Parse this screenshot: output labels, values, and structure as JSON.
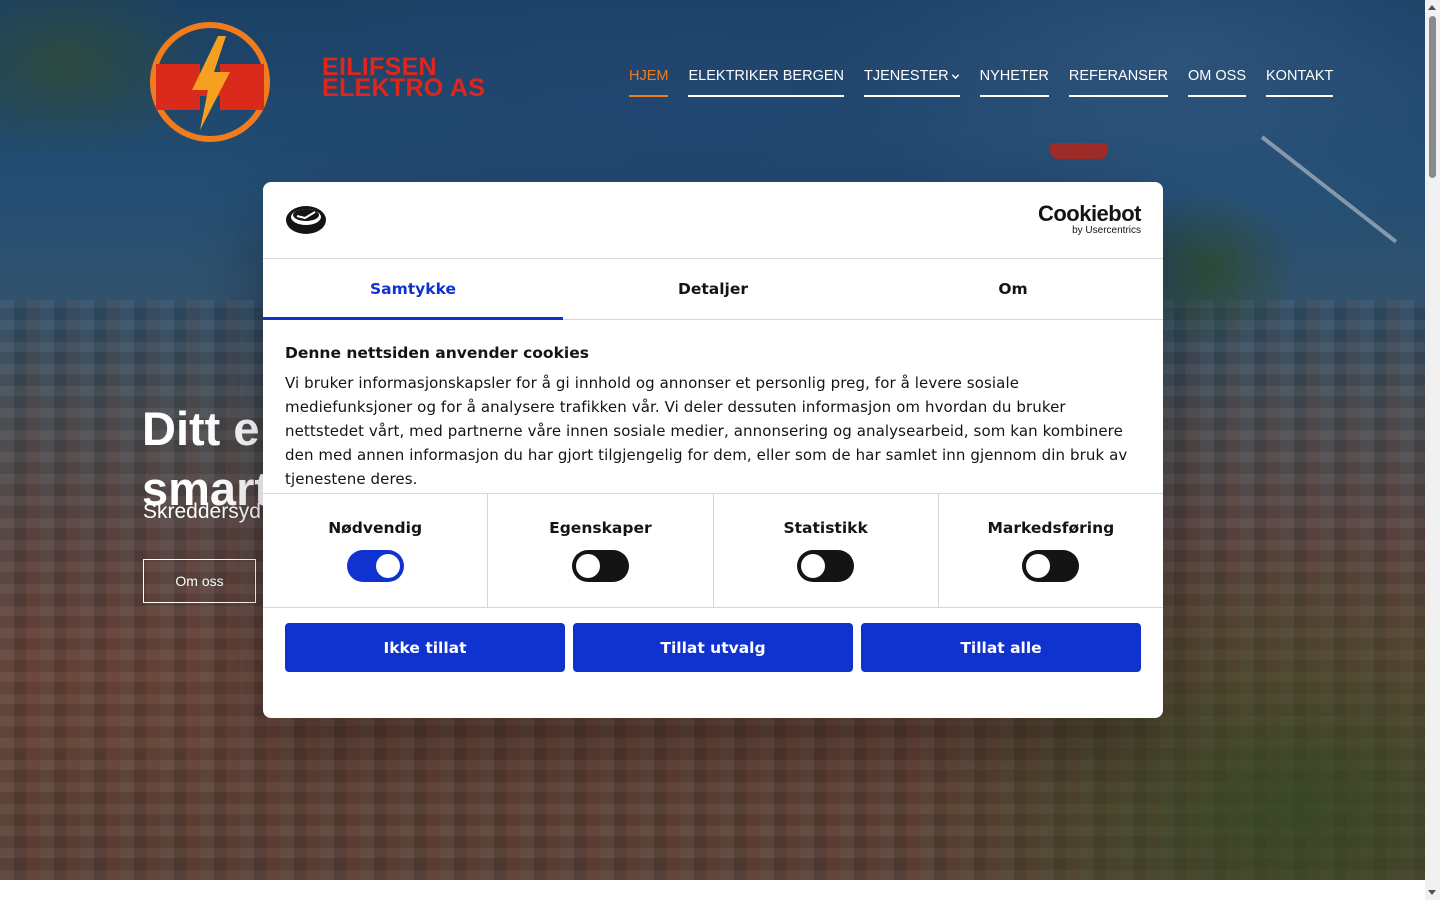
{
  "site": {
    "brand_line1": "EILIFSEN",
    "brand_line2": "ELEKTRO AS",
    "logo_icon": "lightning-logo",
    "brand_color": "#e0261c",
    "accent_color": "#f07c1e"
  },
  "nav": {
    "items": [
      {
        "label": "HJEM",
        "active": true
      },
      {
        "label": "ELEKTRIKER BERGEN"
      },
      {
        "label": "TJENESTER",
        "has_dropdown": true
      },
      {
        "label": "NYHETER"
      },
      {
        "label": "REFERANSER"
      },
      {
        "label": "OM OSS"
      },
      {
        "label": "KONTAKT"
      }
    ]
  },
  "hero": {
    "title_line1": "Ditt e",
    "title_line2": "smart",
    "subtitle": "Skreddersyd",
    "button_label": "Om oss"
  },
  "cookie_dialog": {
    "provider_name": "Cookiebot",
    "provider_by": "by Usercentrics",
    "tabs": [
      {
        "label": "Samtykke",
        "active": true
      },
      {
        "label": "Detaljer"
      },
      {
        "label": "Om"
      }
    ],
    "heading": "Denne nettsiden anvender cookies",
    "body": "Vi bruker informasjonskapsler for å gi innhold og annonser et personlig preg, for å levere sosiale mediefunksjoner og for å analysere trafikken vår. Vi deler dessuten informasjon om hvordan du bruker nettstedet vårt, med partnerne våre innen sosiale medier, annonsering og analysearbeid, som kan kombinere den med annen informasjon du har gjort tilgjengelig for dem, eller som de har samlet inn gjennom din bruk av tjenestene deres.",
    "toggles": [
      {
        "label": "Nødvendig",
        "checked": true
      },
      {
        "label": "Egenskaper",
        "checked": false
      },
      {
        "label": "Statistikk",
        "checked": false
      },
      {
        "label": "Markedsføring",
        "checked": false
      }
    ],
    "buttons": {
      "deny": "Ikke tillat",
      "allow_selection": "Tillat utvalg",
      "allow_all": "Tillat alle"
    },
    "primary_color": "#1032cf"
  }
}
